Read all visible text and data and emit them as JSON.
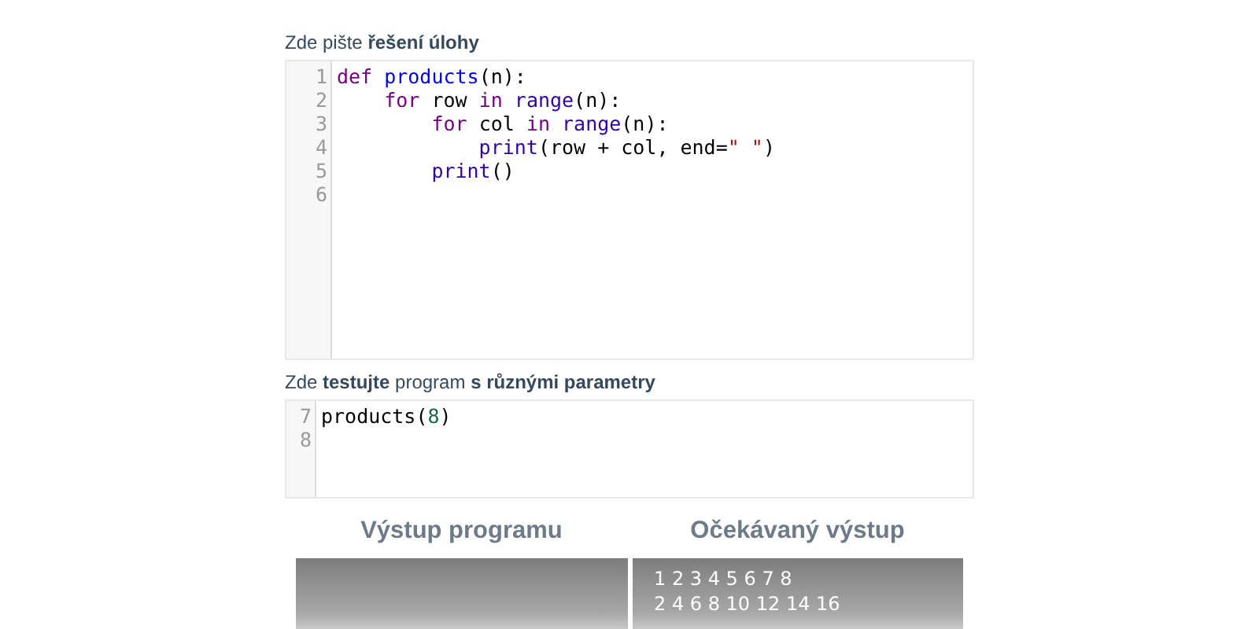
{
  "solution_label": "Zde pište **řešení úlohy**",
  "solution_editor": {
    "lines": [
      {
        "number": "1",
        "tokens": [
          {
            "kind": "keyword",
            "text": "def "
          },
          {
            "kind": "def",
            "text": "products"
          },
          {
            "kind": "plain",
            "text": "(n):"
          }
        ]
      },
      {
        "number": "2",
        "tokens": [
          {
            "kind": "keyword",
            "text": "    for"
          },
          {
            "kind": "plain",
            "text": " row "
          },
          {
            "kind": "keyword",
            "text": "in"
          },
          {
            "kind": "builtin",
            "text": " range"
          },
          {
            "kind": "plain",
            "text": "(n):"
          }
        ]
      },
      {
        "number": "3",
        "tokens": [
          {
            "kind": "keyword",
            "text": "        for"
          },
          {
            "kind": "plain",
            "text": " col "
          },
          {
            "kind": "keyword",
            "text": "in"
          },
          {
            "kind": "builtin",
            "text": " range"
          },
          {
            "kind": "plain",
            "text": "(n):"
          }
        ]
      },
      {
        "number": "4",
        "tokens": [
          {
            "kind": "builtin",
            "text": "            print"
          },
          {
            "kind": "plain",
            "text": "(row + col, end="
          },
          {
            "kind": "string",
            "text": "\" \""
          },
          {
            "kind": "plain",
            "text": ")"
          }
        ]
      },
      {
        "number": "5",
        "tokens": [
          {
            "kind": "builtin",
            "text": "        print"
          },
          {
            "kind": "plain",
            "text": "()"
          }
        ]
      },
      {
        "number": "6"
      }
    ]
  },
  "test_label": "Zde **testujte** program **s různými parametry**",
  "test_editor": {
    "lines": [
      {
        "number": "7",
        "tokens": [
          {
            "kind": "plain",
            "text": "products("
          },
          {
            "kind": "number",
            "text": "8"
          },
          {
            "kind": "plain",
            "text": ")"
          }
        ]
      },
      {
        "number": "8"
      }
    ]
  },
  "outputs": [
    {
      "heading": "Výstup programu"
    },
    {
      "heading": "Očekávaný výstup",
      "lines": [
        "1 2 3 4 5 6 7 8",
        "2 4 6 8 10 12 14 16"
      ]
    }
  ]
}
